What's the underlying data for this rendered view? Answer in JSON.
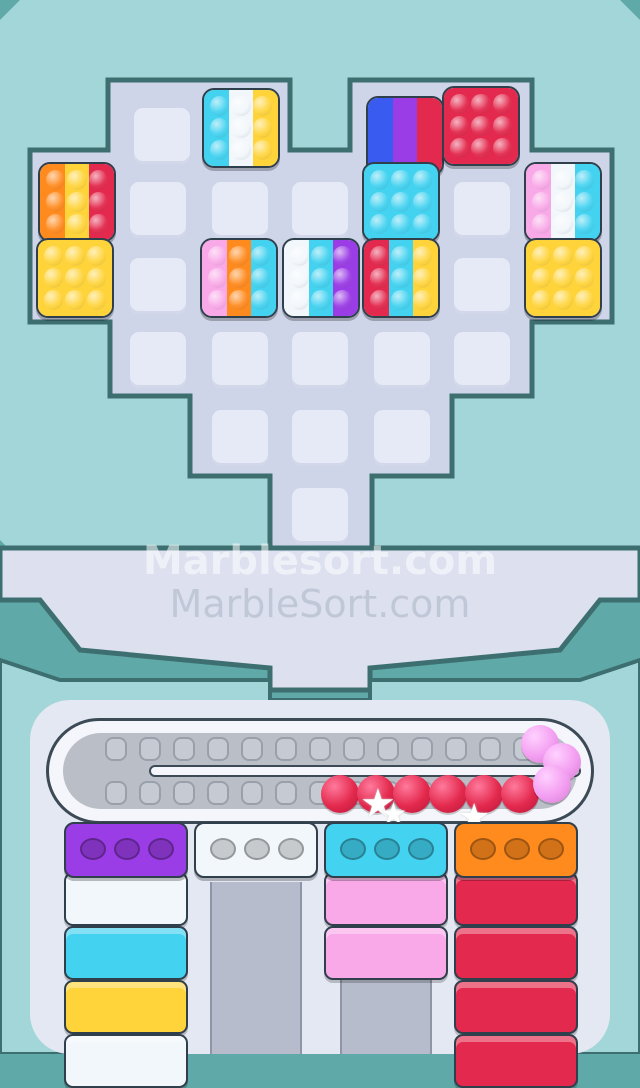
{
  "watermark": {
    "line1": "Marblesort.com",
    "line2": "MarbleSort.com"
  },
  "colors": {
    "background": "#5fa9a8",
    "red": "#e3294d",
    "yellow": "#ffd43b",
    "cyan": "#43d2f0",
    "white": "#f2f7fb",
    "pink": "#f9a9e8",
    "orange": "#ff8a1e",
    "blue": "#3a5bf0",
    "purple": "#9b3de6"
  },
  "board": {
    "blocks": [
      {
        "name": "block-cyan-white-yellow",
        "stripes": [
          "cyan",
          "white",
          "yellow"
        ]
      },
      {
        "name": "block-blue-purple-red",
        "stripes": [
          "blue",
          "purple",
          "red"
        ]
      },
      {
        "name": "block-red",
        "stripes": [
          "red"
        ]
      },
      {
        "name": "block-orange-yellow-red",
        "stripes": [
          "orange",
          "yellow",
          "red"
        ]
      },
      {
        "name": "block-cyan",
        "stripes": [
          "cyan"
        ]
      },
      {
        "name": "block-pink-white-cyan",
        "stripes": [
          "pink",
          "white",
          "cyan"
        ]
      },
      {
        "name": "block-yellow-left",
        "stripes": [
          "yellow"
        ]
      },
      {
        "name": "block-pink-orange-cyan",
        "stripes": [
          "pink",
          "orange",
          "cyan"
        ]
      },
      {
        "name": "block-white-cyan-purple",
        "stripes": [
          "white",
          "cyan",
          "purple"
        ]
      },
      {
        "name": "block-red-cyan-yellow",
        "stripes": [
          "red",
          "cyan",
          "yellow"
        ]
      },
      {
        "name": "block-yellow-right",
        "stripes": [
          "yellow"
        ]
      }
    ]
  },
  "conveyor": {
    "red_balls": 6,
    "pink_balls": 3
  },
  "columns": [
    {
      "name": "column-purple",
      "top": "purple",
      "stack": [
        "white",
        "cyan",
        "yellow",
        "white"
      ]
    },
    {
      "name": "column-white",
      "top": "white",
      "stack": []
    },
    {
      "name": "column-cyan",
      "top": "cyan",
      "stack": [
        "pink",
        "pink"
      ]
    },
    {
      "name": "column-orange",
      "top": "orange",
      "stack": [
        "red",
        "red",
        "red",
        "red"
      ]
    }
  ]
}
